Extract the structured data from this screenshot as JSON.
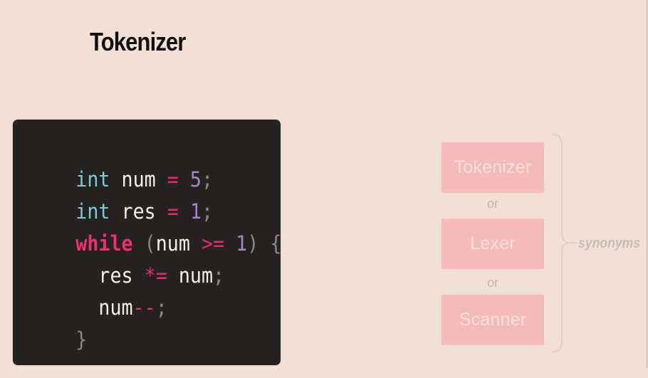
{
  "title": "Tokenizer",
  "code": {
    "line1": {
      "t1": "int",
      "t2": " num ",
      "t3": "=",
      "t4": " ",
      "t5": "5",
      "t6": ";"
    },
    "line2": {
      "t1": "int",
      "t2": " res ",
      "t3": "=",
      "t4": " ",
      "t5": "1",
      "t6": ";"
    },
    "line3": {
      "t1": "while",
      "t2": " (",
      "t3": "num",
      "t4": " ",
      "t5": ">=",
      "t6": " ",
      "t7": "1",
      "t8": ") {"
    },
    "line4": {
      "t1": "  res ",
      "t2": "*=",
      "t3": " num",
      "t4": ";"
    },
    "line5": {
      "t1": "  num",
      "t2": "--",
      "t3": ";"
    },
    "line6": {
      "t1": "}"
    }
  },
  "diagram": {
    "options": [
      "Tokenizer",
      "Lexer",
      "Scanner"
    ],
    "or_label": "or",
    "synonyms_label": "synonyms"
  },
  "colors": {
    "background": "#f2dfd5",
    "code_bg": "#252222",
    "type_keyword": "#7bcbd4",
    "control_keyword": "#ef2f6f",
    "operator": "#e62a6a",
    "number": "#a782c9",
    "identifier": "#f3f1ec",
    "punctuation": "#8b8782",
    "option_fill": "#f6b3b4"
  },
  "icons": {
    "brace": "right-curly-brace"
  }
}
